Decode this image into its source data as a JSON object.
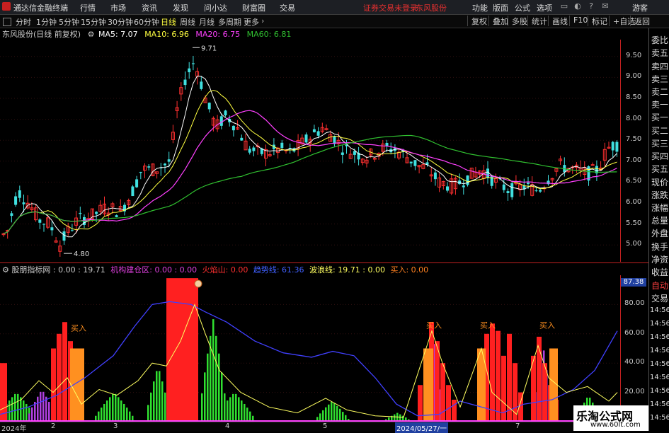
{
  "app": {
    "title": "通达信金融终端",
    "menu": [
      "行情",
      "市场",
      "资讯",
      "发现",
      "问小达",
      "财富圈",
      "交易"
    ],
    "warning": "证券交易未登录",
    "stock_name_top": "东风股份",
    "right_menu": [
      "功能",
      "版面",
      "公式",
      "选项"
    ],
    "user": "游客",
    "win_min": "−",
    "win_max": "□",
    "win_close": "×"
  },
  "periods": {
    "tabs": [
      "分时",
      "1分钟",
      "5分钟",
      "15分钟",
      "30分钟",
      "60分钟",
      "日线",
      "周线",
      "月线",
      "多周期",
      "更多"
    ],
    "active": "日线",
    "tools": [
      "复权",
      "叠加",
      "多股",
      "统计",
      "画线",
      "F10",
      "标记",
      "+自选",
      "返回"
    ]
  },
  "chart_info": {
    "stock": "东风股份(日线 前复权)",
    "ma5": "MA5: 7.07",
    "ma10": "MA10: 6.96",
    "ma20": "MA20: 6.75",
    "ma60": "MA60: 6.81",
    "high_label": "9.71",
    "low_label": "4.80"
  },
  "indicator_info": {
    "name": "股朋指标网",
    "v1": ": 0.00 : 19.71",
    "v2": "机构建仓区: 0.00 : 0.00",
    "v3": "火焰山: 0.00",
    "v4": "趋势线: 61.36",
    "v5": "波浪线: 19.71 : 0.00",
    "v6": "买入: 0.00",
    "buy_label": "买入",
    "current_value": "87.38"
  },
  "axis_main": [
    "9.50",
    "9.00",
    "8.50",
    "8.00",
    "7.50",
    "7.00",
    "6.50",
    "6.00",
    "5.50",
    "5.00"
  ],
  "axis_ind": [
    "80.00",
    "60.00",
    "40.00",
    "20.00"
  ],
  "right_labels": [
    "委比",
    "卖五",
    "卖四",
    "卖三",
    "卖二",
    "卖一",
    "买一",
    "买二",
    "买三",
    "买四",
    "买五",
    "现价",
    "涨跌",
    "涨幅",
    "总量",
    "外盘",
    "换手",
    "净资",
    "收益",
    "自动",
    "交易"
  ],
  "right_times": [
    "14:56",
    "14:56",
    "14:56",
    "14:56",
    "14:56",
    "14:56",
    "14:56",
    "14:56",
    "14:56"
  ],
  "dates": [
    "2024年",
    "2",
    "3",
    "4",
    "5",
    "2024/05/27/一",
    "7"
  ],
  "watermark": {
    "cn": "乐淘公式网",
    "url": "www.60lt.com"
  },
  "colors": {
    "ma5": "#ffffff",
    "ma10": "#ffff40",
    "ma20": "#ff40ff",
    "ma60": "#30c030",
    "up": "#ff3030",
    "down": "#40e0e0",
    "trend": "#4040ff",
    "wave": "#ffff60"
  },
  "chart_data": [
    {
      "type": "candlestick",
      "title": "东风股份(日线 前复权)",
      "ylim": [
        4.6,
        9.9
      ],
      "series": [
        {
          "name": "MA5",
          "values": [
            7.07
          ]
        },
        {
          "name": "MA10",
          "values": [
            6.96
          ]
        },
        {
          "name": "MA20",
          "values": [
            6.75
          ]
        },
        {
          "name": "MA60",
          "values": [
            6.81
          ]
        }
      ],
      "annotations": {
        "high": 9.71,
        "low": 4.8
      }
    },
    {
      "type": "bar",
      "title": "股朋指标网",
      "ylim": [
        0,
        100
      ],
      "series": [
        {
          "name": "趋势线",
          "values": [
            61.36
          ]
        },
        {
          "name": "波浪线",
          "values": [
            19.71
          ]
        }
      ]
    }
  ]
}
